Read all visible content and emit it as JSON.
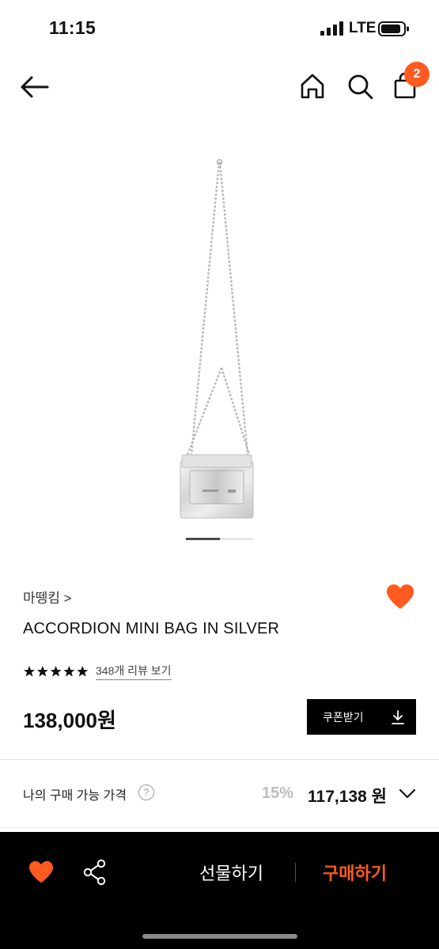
{
  "status": {
    "time": "11:15",
    "network": "LTE"
  },
  "nav": {
    "cart_count": "2",
    "icons": [
      "back-arrow-icon",
      "home-icon",
      "search-icon",
      "shopping-bag-icon"
    ]
  },
  "product": {
    "brand": "마뗑킴 >",
    "name": "ACCORDION MINI BAG IN SILVER",
    "rating": 5,
    "review_link": "348개 리뷰 보기",
    "price": "138,000원",
    "coupon_label": "쿠폰받기",
    "image_index": 1,
    "image_count": 2
  },
  "purchase": {
    "label": "나의 구매 가능 가격",
    "help": "?",
    "discount_rate": "15%",
    "discount_price": "117,138 원"
  },
  "bottom_bar": {
    "gift_label": "선물하기",
    "buy_label": "구매하기"
  },
  "colors": {
    "accent": "#ff5a1f",
    "bar_bg": "#000000"
  }
}
